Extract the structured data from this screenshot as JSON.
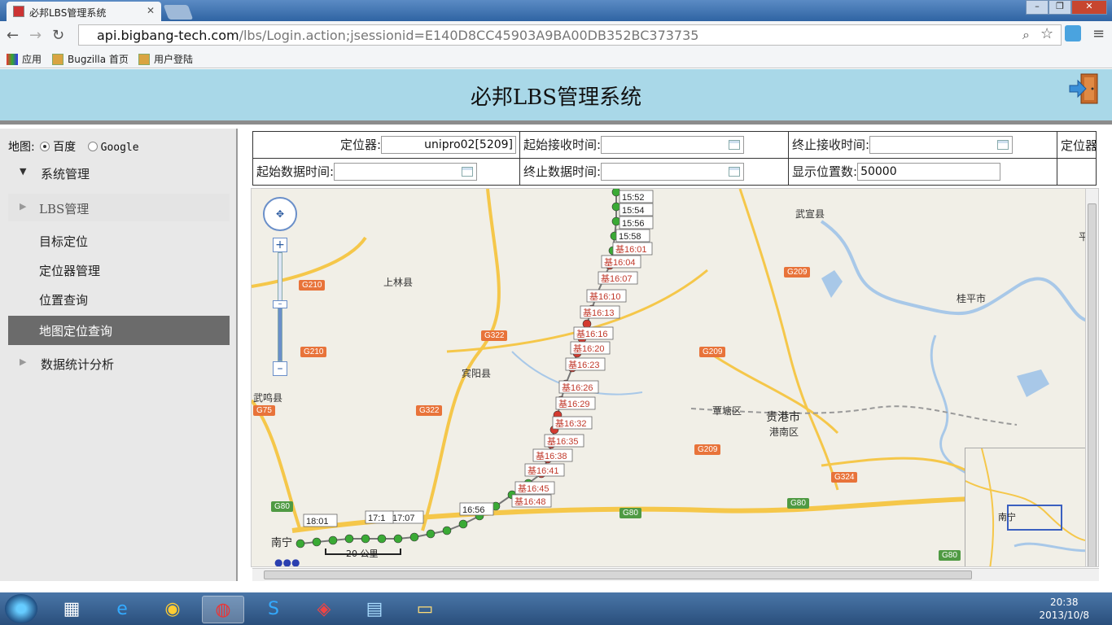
{
  "browser": {
    "tab_title": "必邦LBS管理系统",
    "url_host": "api.bigbang-tech.com",
    "url_path": "/lbs/Login.action;jsessionid=E140D8CC45903A9BA00DB352BC373735",
    "bookmarks": [
      "应用",
      "Bugzilla 首页",
      "用户登陆"
    ]
  },
  "header": {
    "title": "必邦LBS管理系统"
  },
  "sidebar": {
    "map_label": "地图:",
    "map_options": [
      "百度",
      "Google"
    ],
    "map_selected": "百度",
    "group_system": "系统管理",
    "group_lbs": "LBS管理",
    "items": [
      "目标定位",
      "定位器管理",
      "位置查询",
      "地图定位查询"
    ],
    "active_item": "地图定位查询",
    "group_stats": "数据统计分析"
  },
  "filters": {
    "locator_label": "定位器:",
    "locator_value": "unipro02[5209]",
    "start_recv_label": "起始接收时间:",
    "end_recv_label": "终止接收时间:",
    "locator_cut_label": "定位器",
    "start_data_label": "起始数据时间:",
    "end_data_label": "终止数据时间:",
    "count_label": "显示位置数:",
    "count_value": "50000"
  },
  "map": {
    "place_labels": [
      "武宣县",
      "平南",
      "上林县",
      "桂平市",
      "宾阳县",
      "武鸣县",
      "覃塘区",
      "贵港市",
      "港南区",
      "南宁"
    ],
    "road_labels": [
      "G210",
      "G209",
      "G322",
      "G210",
      "G209",
      "G75",
      "G322",
      "G209",
      "G324",
      "G80",
      "G80",
      "G80",
      "G80"
    ],
    "time_labels": [
      "15:52",
      "15:54",
      "15:56",
      "15:58",
      "基16:01",
      "基16:04",
      "基16:07",
      "基16:10",
      "基16:13",
      "基16:16",
      "基16:20",
      "基16:23",
      "基16:26",
      "基16:29",
      "基16:32",
      "基16:35",
      "基16:38",
      "基16:41",
      "基16:45",
      "基16:48",
      "16:56",
      "17:07",
      "17:1",
      "18:01"
    ],
    "scale_label": "20 公里",
    "inset_label": "南宁",
    "colors": {
      "green_marker": "#3aaa35",
      "red_marker": "#d43a2f",
      "road": "#f5c74a",
      "water": "#a8c8e8"
    }
  },
  "taskbar": {
    "time": "20:38",
    "date": "2013/10/8"
  }
}
